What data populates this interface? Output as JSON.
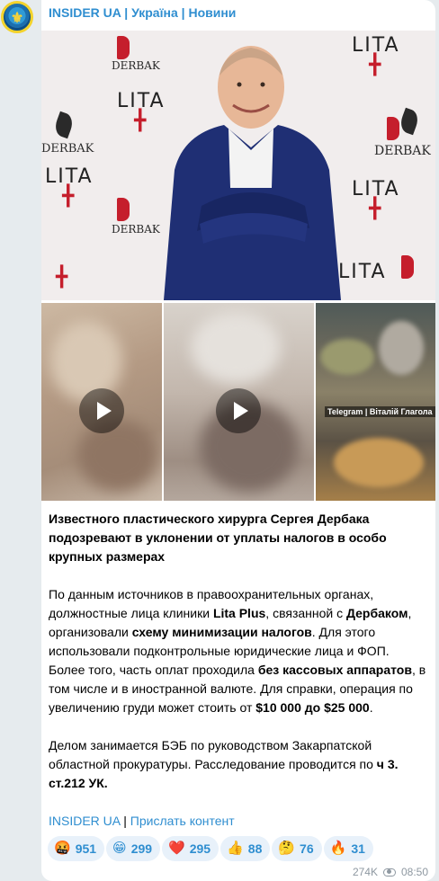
{
  "channel": {
    "avatar_icon": "trident-icon",
    "avatar_text": "⚜",
    "name": "INSIDER UA | Україна | Новини"
  },
  "media": {
    "main_photo": {
      "brand_text": "DERBAK",
      "logo_text": "LITA",
      "logo_sub": "LITA PLUS"
    },
    "videos": [
      {
        "icon": "play-icon"
      },
      {
        "icon": "play-icon"
      }
    ],
    "photo_watermark": "Telegram | Віталій Глагола"
  },
  "post": {
    "lead": "Известного пластического хирурга Сергея Дербака подозревают в уклонении от уплаты налогов в особо крупных размерах",
    "body": {
      "p1": "По данным источников в правоохранительных органах, должностные лица клиники ",
      "b1": "Lita Plus",
      "p2": ", связанной с ",
      "b2": "Дербаком",
      "p3": ", организовали ",
      "b3": "схему минимизации налогов",
      "p4": ". Для этого использовали подконтрольные юридические лица и ФОП. Более того, часть оплат проходила ",
      "b4": "без кассовых аппаратов",
      "p5": ", в том числе и в иностранной валюте. Для справки, операция по увеличению груди может стоить от ",
      "b5": "$10 000 до $25 000",
      "p6": "."
    },
    "tail": {
      "p1": "Делом занимается БЭБ по руководством Закарпатской областной прокуратуры. Расследование проводится по ",
      "b1": "ч 3. ст.212 УК."
    },
    "links": {
      "channel": "INSIDER UA",
      "separator": " | ",
      "submit": "Прислать контент"
    }
  },
  "reactions": [
    {
      "emoji": "🤬",
      "icon": "enraged-face-icon",
      "count": "951"
    },
    {
      "emoji": "😁",
      "icon": "grinning-face-icon",
      "count": "299"
    },
    {
      "emoji": "❤️",
      "icon": "red-heart-icon",
      "count": "295"
    },
    {
      "emoji": "👍",
      "icon": "thumbs-up-icon",
      "count": "88"
    },
    {
      "emoji": "🤔",
      "icon": "thinking-face-icon",
      "count": "76"
    },
    {
      "emoji": "🔥",
      "icon": "fire-icon",
      "count": "31"
    }
  ],
  "meta": {
    "views": "274K",
    "views_icon": "eye-icon",
    "time": "08:50"
  },
  "colors": {
    "background": "#e6ebee",
    "bubble": "#ffffff",
    "link": "#2f8ed0",
    "reaction_bg": "#e8f1fa",
    "meta_text": "#8e98a1",
    "brand_red": "#c51e2c"
  }
}
